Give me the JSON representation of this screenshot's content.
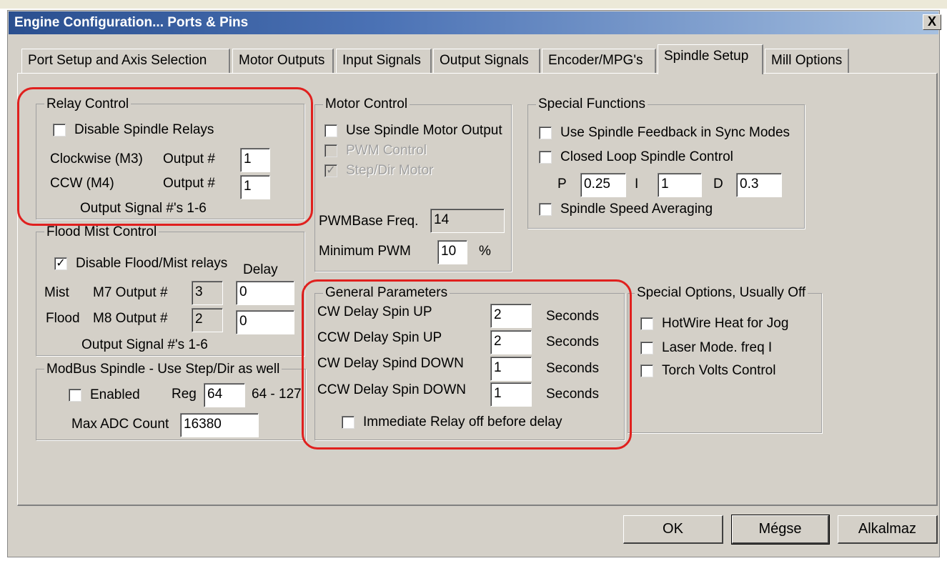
{
  "window": {
    "title": "Engine Configuration... Ports & Pins",
    "close_label": "X"
  },
  "tabs": [
    {
      "label": "Port Setup and Axis Selection",
      "active": false
    },
    {
      "label": "Motor Outputs",
      "active": false
    },
    {
      "label": "Input Signals",
      "active": false
    },
    {
      "label": "Output Signals",
      "active": false
    },
    {
      "label": "Encoder/MPG's",
      "active": false
    },
    {
      "label": "Spindle Setup",
      "active": true
    },
    {
      "label": "Mill Options",
      "active": false
    }
  ],
  "relay_control": {
    "title": "Relay Control",
    "disable_label": "Disable Spindle Relays",
    "disable_checked": false,
    "cw_label": "Clockwise (M3)",
    "cw_output_label": "Output #",
    "cw_output": "1",
    "ccw_label": "CCW (M4)",
    "ccw_output_label": "Output #",
    "ccw_output": "1",
    "note": "Output Signal #'s 1-6"
  },
  "flood_mist": {
    "title": "Flood Mist Control",
    "disable_label": "Disable Flood/Mist relays",
    "disable_checked": true,
    "delay_label": "Delay",
    "mist_label": "Mist",
    "mist_output_label": "M7 Output #",
    "mist_output": "3",
    "mist_delay": "0",
    "flood_label": "Flood",
    "flood_output_label": "M8 Output #",
    "flood_output": "2",
    "flood_delay": "0",
    "note": "Output Signal #'s 1-6"
  },
  "modbus": {
    "title": "ModBus Spindle - Use Step/Dir as well",
    "enabled_label": "Enabled",
    "enabled_checked": false,
    "reg_label": "Reg",
    "reg_value": "64",
    "reg_range": "64 - 127",
    "max_adc_label": "Max ADC Count",
    "max_adc_value": "16380"
  },
  "motor_control": {
    "title": "Motor Control",
    "use_spindle_label": "Use Spindle Motor Output",
    "use_spindle_checked": false,
    "pwm_label": "PWM Control",
    "pwm_checked": false,
    "stepdir_label": "Step/Dir Motor",
    "stepdir_checked": true,
    "pwm_base_label": "PWMBase Freq.",
    "pwm_base_value": "14",
    "min_pwm_label": "Minimum PWM",
    "min_pwm_value": "10",
    "min_pwm_unit": "%"
  },
  "special_functions": {
    "title": "Special Functions",
    "feedback_label": "Use Spindle Feedback in Sync Modes",
    "feedback_checked": false,
    "closed_loop_label": "Closed Loop Spindle Control",
    "closed_loop_checked": false,
    "p_label": "P",
    "p_value": "0.25",
    "i_label": "I",
    "i_value": "1",
    "d_label": "D",
    "d_value": "0.3",
    "averaging_label": "Spindle Speed Averaging",
    "averaging_checked": false
  },
  "general_params": {
    "title": "General Parameters",
    "rows": [
      {
        "label": "CW Delay Spin UP",
        "value": "2",
        "unit": "Seconds"
      },
      {
        "label": "CCW Delay Spin UP",
        "value": "2",
        "unit": "Seconds"
      },
      {
        "label": "CW Delay Spind DOWN",
        "value": "1",
        "unit": "Seconds"
      },
      {
        "label": "CCW Delay Spin DOWN",
        "value": "1",
        "unit": "Seconds"
      }
    ],
    "immediate_label": "Immediate Relay off before delay",
    "immediate_checked": false
  },
  "special_options": {
    "title": "Special Options, Usually Off",
    "hotwire_label": "HotWire Heat for Jog",
    "hotwire_checked": false,
    "laser_label": "Laser Mode. freq I",
    "laser_checked": false,
    "torch_label": "Torch Volts Control",
    "torch_checked": false
  },
  "buttons": {
    "ok": "OK",
    "cancel": "Mégse",
    "apply": "Alkalmaz"
  },
  "colors": {
    "title_bar": "#2a4f8f",
    "dialog_bg": "#d4d0c8",
    "highlight_ring": "#e0201e"
  }
}
